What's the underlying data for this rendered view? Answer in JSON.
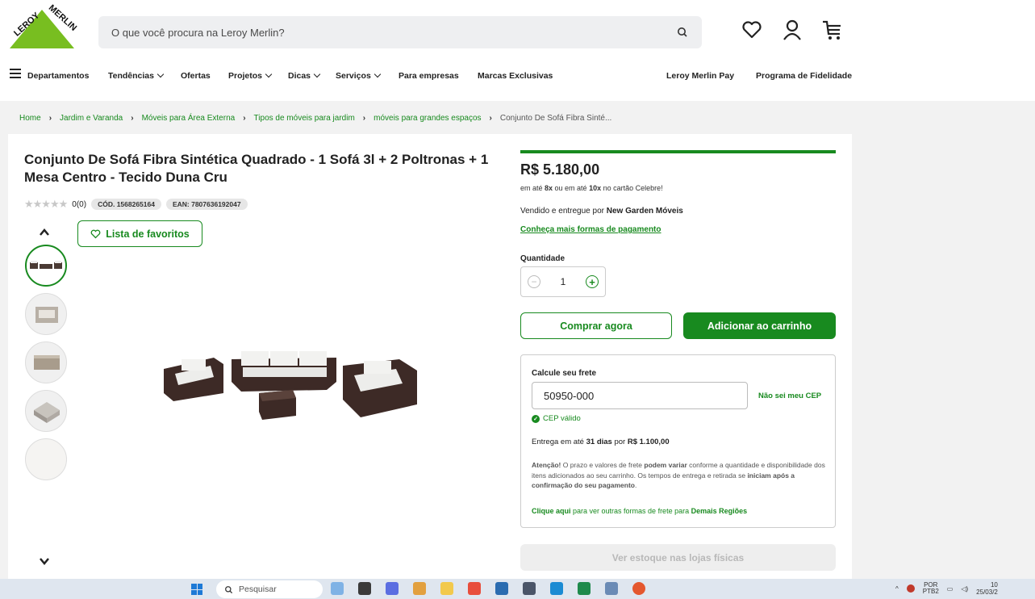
{
  "header": {
    "logo_text": "LEROY MERLIN",
    "search_placeholder": "O que você procura na Leroy Merlin?"
  },
  "nav": {
    "departments": "Departamentos",
    "items": [
      "Tendências",
      "Ofertas",
      "Projetos",
      "Dicas",
      "Serviços",
      "Para empresas",
      "Marcas Exclusivas"
    ],
    "pay": "Leroy Merlin Pay",
    "loyalty": "Programa de Fidelidade"
  },
  "breadcrumb": [
    "Home",
    "Jardim e Varanda",
    "Móveis para Área Externa",
    "Tipos de móveis para jardim",
    "móveis para grandes espaços",
    "Conjunto De Sofá Fibra Sinté..."
  ],
  "product": {
    "title": "Conjunto De Sofá Fibra Sintética Quadrado - 1 Sofá 3l + 2 Poltronas + 1 Mesa Centro - Tecido Duna Cru",
    "rating_count": "0(0)",
    "code": "CÓD. 1568265164",
    "ean": "EAN: 7807636192047",
    "favorites_label": "Lista de favoritos",
    "thumbnails_count": 5
  },
  "buy": {
    "price": "R$ 5.180,00",
    "installments_a": "em até ",
    "installments_b": "8x",
    "installments_c": " ou em até ",
    "installments_d": "10x",
    "installments_e": " no cartão Celebre!",
    "seller_prefix": "Vendido e entregue por ",
    "seller_name": "New Garden Móveis",
    "payment_link": "Conheça mais formas de pagamento",
    "quantity_label": "Quantidade",
    "quantity": "1",
    "buy_now": "Comprar agora",
    "add_to_cart": "Adicionar ao carrinho",
    "stock_button": "Ver estoque nas lojas físicas"
  },
  "shipping": {
    "title": "Calcule seu frete",
    "cep": "50950-000",
    "unknown_cep": "Não sei meu CEP",
    "valid": "CEP válido",
    "delivery_a": "Entrega em até ",
    "delivery_b": "31 dias",
    "delivery_c": " por ",
    "delivery_d": "R$ 1.100,00",
    "warning_a": "Atenção!",
    "warning_b": " O prazo e valores de frete ",
    "warning_c": "podem variar",
    "warning_d": " conforme a quantidade e disponibilidade dos itens adicionados ao seu carrinho. Os tempos de entrega e retirada se ",
    "warning_e": "iniciam após a confirmação do seu pagamento",
    "warning_f": ".",
    "other_a": "Clique aqui",
    "other_b": " para ver outras formas de frete para ",
    "other_c": "Demais Regiões"
  },
  "taskbar": {
    "search": "Pesquisar",
    "lang": "POR",
    "lang2": "PTB2",
    "time": "10",
    "date": "25/03/2"
  },
  "colors": {
    "brand_green": "#188a1f"
  }
}
